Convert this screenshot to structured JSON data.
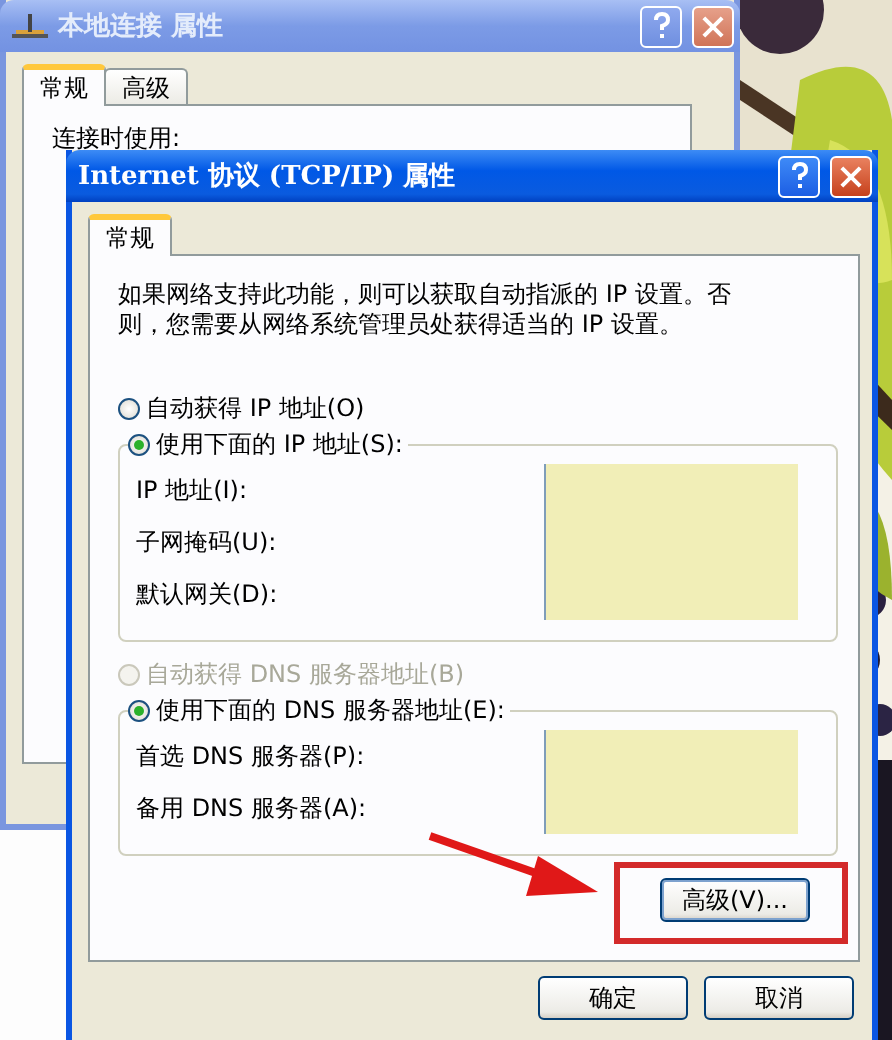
{
  "back_window": {
    "title": "本地连接 属性",
    "tabs": [
      {
        "label": "常规",
        "selected": true
      },
      {
        "label": "高级",
        "selected": false
      }
    ],
    "label": "连接时使用:"
  },
  "window": {
    "title": "Internet 协议 (TCP/IP) 属性",
    "tabs": [
      {
        "label": "常规",
        "selected": true
      }
    ],
    "description": "如果网络支持此功能，则可以获取自动指派的 IP 设置。否则，您需要从网络系统管理员处获得适当的 IP 设置。",
    "ip_auto": {
      "label": "自动获得 IP 地址(O)",
      "selected": false,
      "disabled": false
    },
    "ip_manual": {
      "label": "使用下面的 IP 地址(S):",
      "selected": true,
      "disabled": false
    },
    "ip_fields": [
      {
        "label": "IP 地址(I):"
      },
      {
        "label": "子网掩码(U):"
      },
      {
        "label": "默认网关(D):"
      }
    ],
    "dns_auto": {
      "label": "自动获得 DNS 服务器地址(B)",
      "selected": false,
      "disabled": true
    },
    "dns_manual": {
      "label": "使用下面的 DNS 服务器地址(E):",
      "selected": true,
      "disabled": false
    },
    "dns_fields": [
      {
        "label": "首选 DNS 服务器(P):"
      },
      {
        "label": "备用 DNS 服务器(A):"
      }
    ],
    "advanced_button": "高级(V)...",
    "buttons": [
      "确定",
      "取消"
    ]
  }
}
